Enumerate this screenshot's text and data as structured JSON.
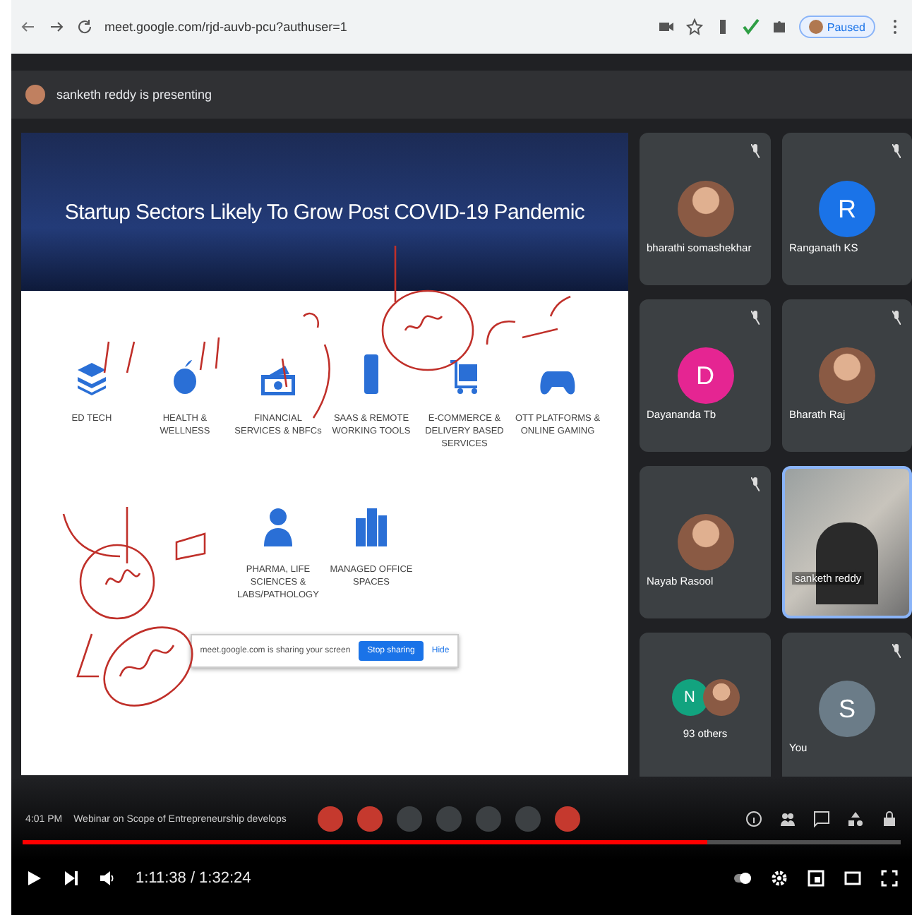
{
  "browser": {
    "url": "meet.google.com/rjd-auvb-pcu?authuser=1",
    "profile_button": "Paused"
  },
  "presenting_banner": "sanketh reddy is presenting",
  "slide": {
    "title": "Startup Sectors Likely To Grow Post COVID-19 Pandemic",
    "sectors": [
      {
        "label": "ED TECH",
        "kind": "layers"
      },
      {
        "label": "HEALTH & WELLNESS",
        "kind": "apple"
      },
      {
        "label": "FINANCIAL SERVICES & NBFCs",
        "kind": "money"
      },
      {
        "label": "SAAS & REMOTE WORKING TOOLS",
        "kind": "phone"
      },
      {
        "label": "E-COMMERCE & DELIVERY BASED SERVICES",
        "kind": "cart"
      },
      {
        "label": "OTT PLATFORMS & ONLINE GAMING",
        "kind": "gamepad"
      },
      {
        "label": "PHARMA, LIFE SCIENCES & LABS/PATHOLOGY",
        "kind": "person"
      },
      {
        "label": "MANAGED OFFICE SPACES",
        "kind": "buildings"
      }
    ],
    "share_bar": {
      "message": "meet.google.com is sharing your screen",
      "stop_button": "Stop sharing",
      "hide_button": "Hide"
    }
  },
  "participants": [
    {
      "name": "bharathi somashekhar",
      "kind": "photo",
      "muted": true,
      "speaking": false
    },
    {
      "name": "Ranganath KS",
      "kind": "letter",
      "initial": "R",
      "color": "#1a73e8",
      "muted": true,
      "speaking": false
    },
    {
      "name": "Dayananda Tb",
      "kind": "letter",
      "initial": "D",
      "color": "#e52592",
      "muted": true,
      "speaking": false
    },
    {
      "name": "Bharath Raj",
      "kind": "photo",
      "muted": true,
      "speaking": false
    },
    {
      "name": "Nayab Rasool",
      "kind": "photo",
      "muted": true,
      "speaking": false
    },
    {
      "name": "sanketh reddy",
      "kind": "video",
      "muted": false,
      "speaking": true
    },
    {
      "name": "93 others",
      "kind": "group",
      "initial": "N",
      "color": "#12a37f",
      "muted": false,
      "speaking": false
    },
    {
      "name": "You",
      "kind": "letter",
      "initial": "S",
      "color": "#6b7c88",
      "muted": true,
      "speaking": false
    }
  ],
  "meet_bar": {
    "time": "4:01 PM",
    "meeting_name": "Webinar on Scope of Entrepreneurship develops"
  },
  "player": {
    "level": 0.78,
    "time": "1:11:38 / 1:32:24"
  }
}
